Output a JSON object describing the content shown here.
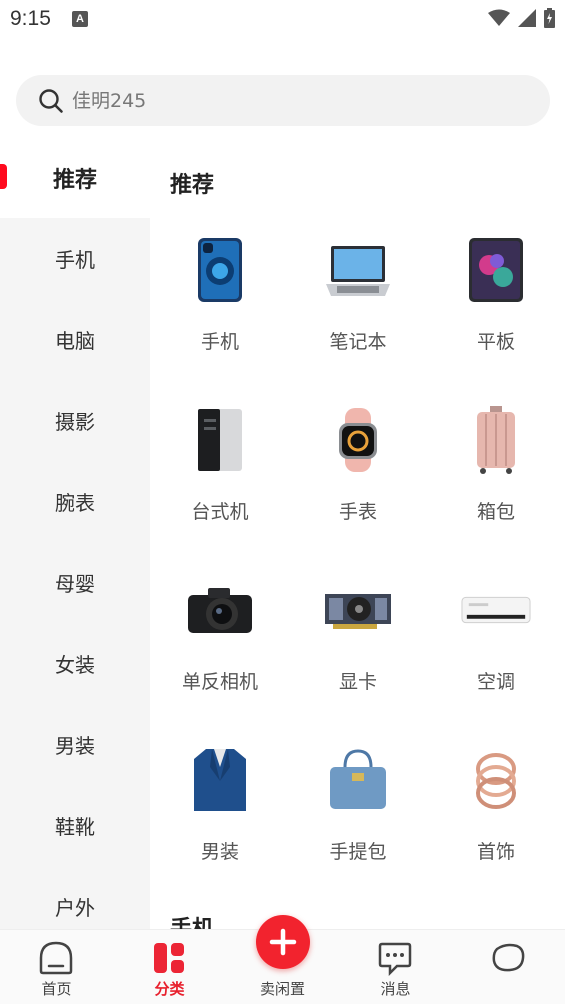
{
  "status_bar": {
    "time": "9:15",
    "notification_badge": "A"
  },
  "search": {
    "placeholder": "佳明245"
  },
  "sidebar": {
    "items": [
      {
        "label": "推荐",
        "active": true
      },
      {
        "label": "手机"
      },
      {
        "label": "电脑"
      },
      {
        "label": "摄影"
      },
      {
        "label": "腕表"
      },
      {
        "label": "母婴"
      },
      {
        "label": "女装"
      },
      {
        "label": "男装"
      },
      {
        "label": "鞋靴"
      },
      {
        "label": "户外"
      }
    ]
  },
  "main": {
    "section_title": "推荐",
    "next_section_title": "手机",
    "grid": [
      {
        "label": "手机",
        "icon": "iphone-image"
      },
      {
        "label": "笔记本",
        "icon": "laptop-image"
      },
      {
        "label": "平板",
        "icon": "tablet-image"
      },
      {
        "label": "台式机",
        "icon": "desktop-tower-image"
      },
      {
        "label": "手表",
        "icon": "smartwatch-image"
      },
      {
        "label": "箱包",
        "icon": "suitcase-image"
      },
      {
        "label": "单反相机",
        "icon": "dslr-camera-image"
      },
      {
        "label": "显卡",
        "icon": "graphics-card-image"
      },
      {
        "label": "空调",
        "icon": "air-conditioner-image"
      },
      {
        "label": "男装",
        "icon": "blazer-image"
      },
      {
        "label": "手提包",
        "icon": "handbag-image"
      },
      {
        "label": "首饰",
        "icon": "ring-image"
      }
    ]
  },
  "bottom_nav": {
    "items": [
      {
        "label": "首页",
        "icon": "home-icon"
      },
      {
        "label": "分类",
        "icon": "category-icon",
        "active": true
      },
      {
        "label": "卖闲置",
        "icon": "plus-icon"
      },
      {
        "label": "消息",
        "icon": "message-icon"
      },
      {
        "label": "",
        "icon": "profile-blob-icon"
      }
    ]
  },
  "colors": {
    "accent": "#f2232e",
    "sidebar_bg": "#f5f5f5",
    "search_bg": "#f2f2f2"
  }
}
